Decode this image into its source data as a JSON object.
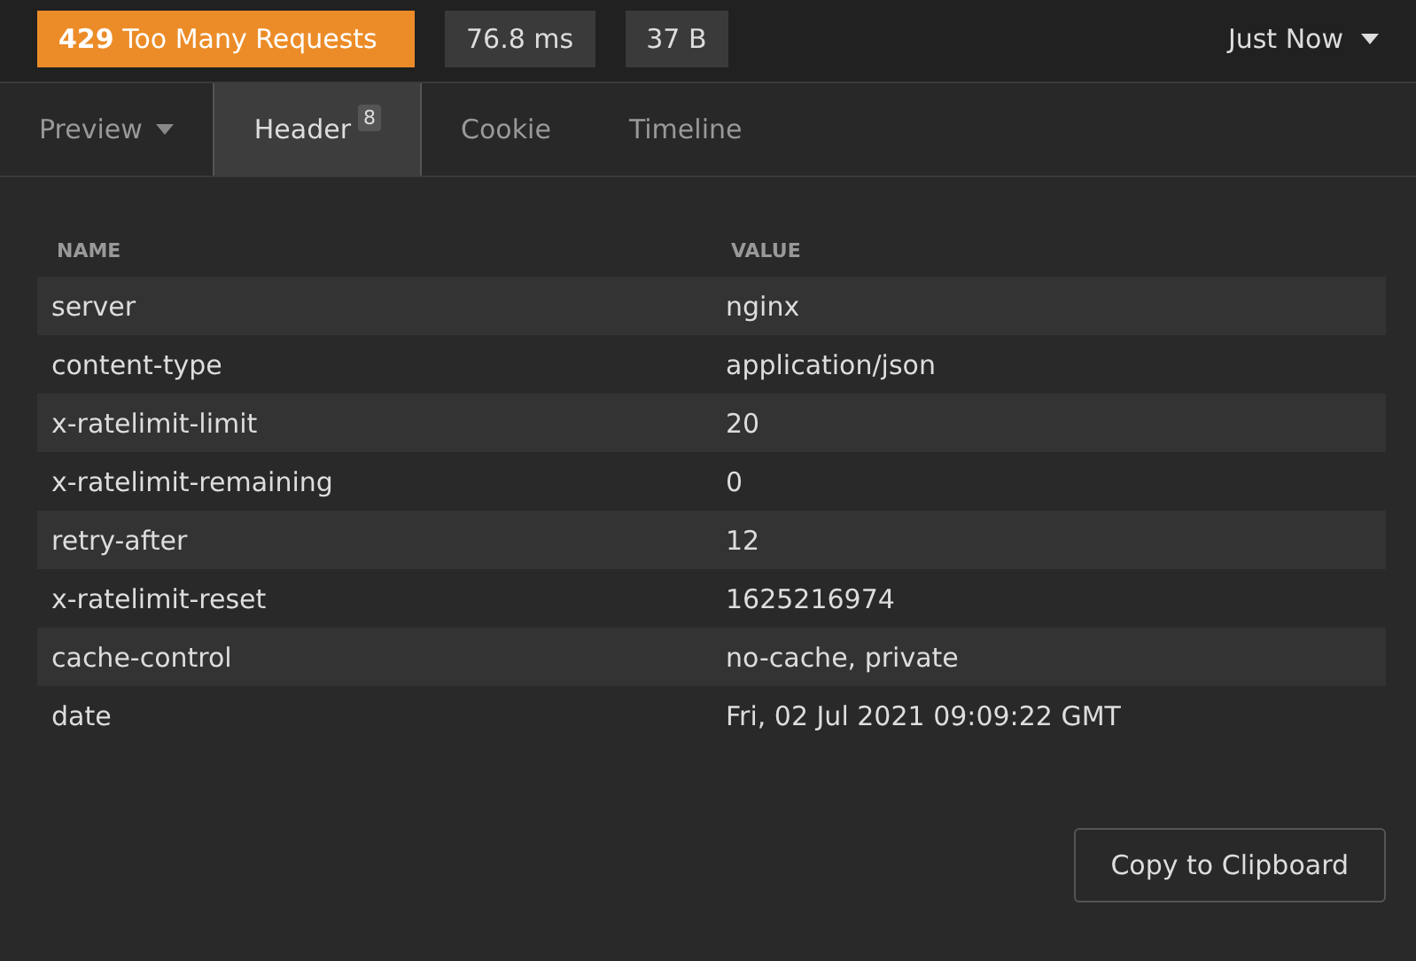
{
  "status": {
    "text": "**429** Too Many Requests",
    "time": "76.8 ms",
    "size": "37 B"
  },
  "history": {
    "label": "Just Now"
  },
  "tabs": [
    {
      "label": "Preview",
      "selected": false,
      "dropdown": true
    },
    {
      "label": "Header",
      "selected": true,
      "count": "8"
    },
    {
      "label": "Cookie",
      "selected": false
    },
    {
      "label": "Timeline",
      "selected": false
    }
  ],
  "table": {
    "columns": [
      "NAME",
      "VALUE"
    ],
    "rows": [
      [
        "server",
        "nginx"
      ],
      [
        "content-type",
        "application/json"
      ],
      [
        "x-ratelimit-limit",
        "20"
      ],
      [
        "x-ratelimit-remaining",
        "0"
      ],
      [
        "retry-after",
        "12"
      ],
      [
        "x-ratelimit-reset",
        "1625216974"
      ],
      [
        "cache-control",
        "no-cache, private"
      ],
      [
        "date",
        "Fri, 02 Jul 2021 09:09:22 GMT"
      ]
    ]
  },
  "buttons": [
    "Copy to Clipboard"
  ]
}
